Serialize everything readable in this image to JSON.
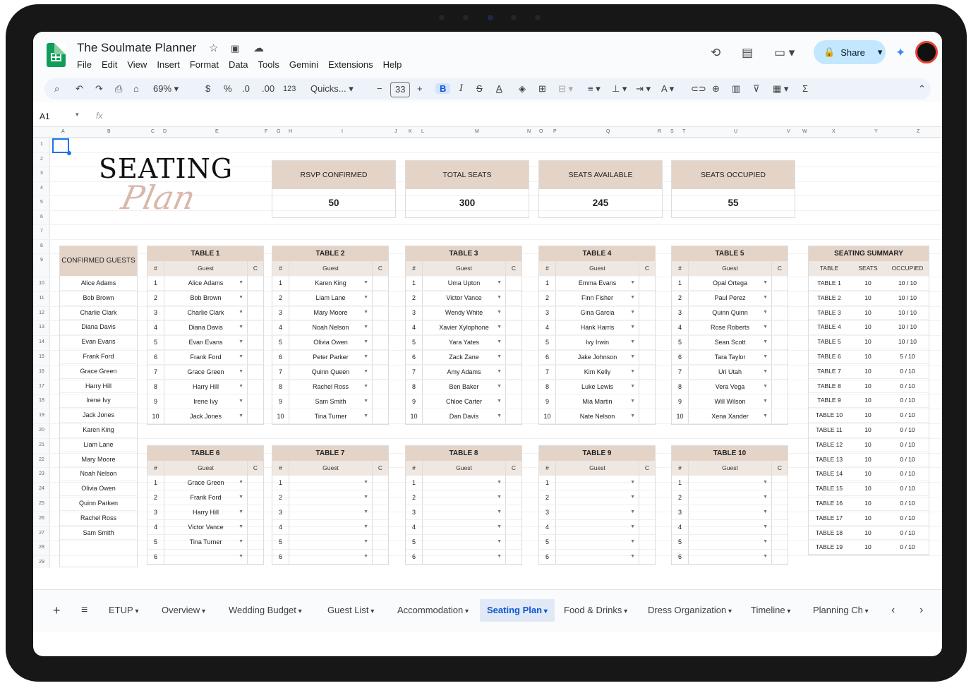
{
  "app": {
    "title": "The Soulmate Planner",
    "menu": [
      "File",
      "Edit",
      "View",
      "Insert",
      "Format",
      "Data",
      "Tools",
      "Gemini",
      "Extensions",
      "Help"
    ],
    "share_label": "Share"
  },
  "toolbar": {
    "zoom": "69%",
    "currency": "$",
    "percent": "%",
    "dec_less": ".0",
    "dec_more": ".00",
    "num_format": "123",
    "font": "Quicks...",
    "font_size": "33"
  },
  "formula_bar": {
    "cell_ref": "A1",
    "fx": "fx"
  },
  "columns": [
    "A",
    "B",
    "C",
    "D",
    "E",
    "F",
    "G",
    "H",
    "I",
    "J",
    "K",
    "L",
    "M",
    "N",
    "O",
    "P",
    "Q",
    "R",
    "S",
    "T",
    "U",
    "V",
    "W",
    "X",
    "Y",
    "Z"
  ],
  "rows": [
    "1",
    "2",
    "3",
    "4",
    "5",
    "6",
    "7",
    "8",
    "9",
    "10",
    "11",
    "12",
    "13",
    "14",
    "15",
    "16",
    "17",
    "18",
    "19",
    "20",
    "21",
    "22",
    "23",
    "24",
    "25",
    "26",
    "27",
    "28",
    "29"
  ],
  "header": {
    "line1": "SEATING",
    "line2": "Plan"
  },
  "stats": [
    {
      "label": "RSVP CONFIRMED",
      "value": "50"
    },
    {
      "label": "TOTAL SEATS",
      "value": "300"
    },
    {
      "label": "SEATS AVAILABLE",
      "value": "245"
    },
    {
      "label": "SEATS OCCUPIED",
      "value": "55"
    }
  ],
  "confirmed": {
    "title": "CONFIRMED GUESTS",
    "guests": [
      "Alice Adams",
      "Bob Brown",
      "Charlie Clark",
      "Diana Davis",
      "Evan Evans",
      "Frank Ford",
      "Grace Green",
      "Harry Hill",
      "Irene Ivy",
      "Jack Jones",
      "Karen King",
      "Liam Lane",
      "Mary Moore",
      "Noah Nelson",
      "Olivia Owen",
      "Quinn Parken",
      "Rachel Ross",
      "Sam Smith"
    ]
  },
  "col_labels": {
    "num": "#",
    "guest": "Guest",
    "c": "C"
  },
  "tables": [
    {
      "name": "TABLE 1",
      "guests": [
        "Alice Adams",
        "Bob Brown",
        "Charlie Clark",
        "Diana Davis",
        "Evan Evans",
        "Frank Ford",
        "Grace Green",
        "Harry Hill",
        "Irene Ivy",
        "Jack Jones"
      ]
    },
    {
      "name": "TABLE 2",
      "guests": [
        "Karen King",
        "Liam Lane",
        "Mary Moore",
        "Noah Nelson",
        "Olivia Owen",
        "Peter Parker",
        "Quinn Queen",
        "Rachel Ross",
        "Sam Smith",
        "Tina Turner"
      ]
    },
    {
      "name": "TABLE 3",
      "guests": [
        "Uma Upton",
        "Victor Vance",
        "Wendy White",
        "Xavier Xylophone",
        "Yara Yates",
        "Zack Zane",
        "Amy Adams",
        "Ben Baker",
        "Chloe Carter",
        "Dan Davis"
      ]
    },
    {
      "name": "TABLE 4",
      "guests": [
        "Emma Evans",
        "Finn Fisher",
        "Gina Garcia",
        "Hank Harris",
        "Ivy Irwin",
        "Jake Johnson",
        "Kim Kelly",
        "Luke Lewis",
        "Mia Martin",
        "Nate Nelson"
      ]
    },
    {
      "name": "TABLE 5",
      "guests": [
        "Opal Ortega",
        "Paul Perez",
        "Quinn Quinn",
        "Rose Roberts",
        "Sean Scott",
        "Tara Taylor",
        "Uri Utah",
        "Vera Vega",
        "Will Wilson",
        "Xena Xander"
      ]
    },
    {
      "name": "TABLE 6",
      "guests": [
        "Grace Green",
        "Frank Ford",
        "Harry Hill",
        "Victor Vance",
        "Tina Turner",
        ""
      ]
    },
    {
      "name": "TABLE 7",
      "guests": [
        "",
        "",
        "",
        "",
        "",
        ""
      ]
    },
    {
      "name": "TABLE 8",
      "guests": [
        "",
        "",
        "",
        "",
        "",
        ""
      ]
    },
    {
      "name": "TABLE 9",
      "guests": [
        "",
        "",
        "",
        "",
        "",
        ""
      ]
    },
    {
      "name": "TABLE 10",
      "guests": [
        "",
        "",
        "",
        "",
        "",
        ""
      ]
    }
  ],
  "summary": {
    "title": "SEATING SUMMARY",
    "cols": [
      "TABLE",
      "SEATS",
      "OCCUPIED"
    ],
    "rows": [
      [
        "TABLE 1",
        "10",
        "10 / 10"
      ],
      [
        "TABLE 2",
        "10",
        "10 / 10"
      ],
      [
        "TABLE 3",
        "10",
        "10 / 10"
      ],
      [
        "TABLE 4",
        "10",
        "10 / 10"
      ],
      [
        "TABLE 5",
        "10",
        "10 / 10"
      ],
      [
        "TABLE 6",
        "10",
        "5 / 10"
      ],
      [
        "TABLE 7",
        "10",
        "0 / 10"
      ],
      [
        "TABLE 8",
        "10",
        "0 / 10"
      ],
      [
        "TABLE 9",
        "10",
        "0 / 10"
      ],
      [
        "TABLE 10",
        "10",
        "0 / 10"
      ],
      [
        "TABLE 11",
        "10",
        "0 / 10"
      ],
      [
        "TABLE 12",
        "10",
        "0 / 10"
      ],
      [
        "TABLE 13",
        "10",
        "0 / 10"
      ],
      [
        "TABLE 14",
        "10",
        "0 / 10"
      ],
      [
        "TABLE 15",
        "10",
        "0 / 10"
      ],
      [
        "TABLE 16",
        "10",
        "0 / 10"
      ],
      [
        "TABLE 17",
        "10",
        "0 / 10"
      ],
      [
        "TABLE 18",
        "10",
        "0 / 10"
      ],
      [
        "TABLE 19",
        "10",
        "0 / 10"
      ]
    ]
  },
  "sheet_tabs": [
    "ETUP",
    "Overview",
    "Wedding Budget",
    "Guest List",
    "Accommodation",
    "Seating Plan",
    "Food & Drinks",
    "Dress Organization",
    "Timeline",
    "Planning Ch"
  ],
  "active_tab": "Seating Plan"
}
